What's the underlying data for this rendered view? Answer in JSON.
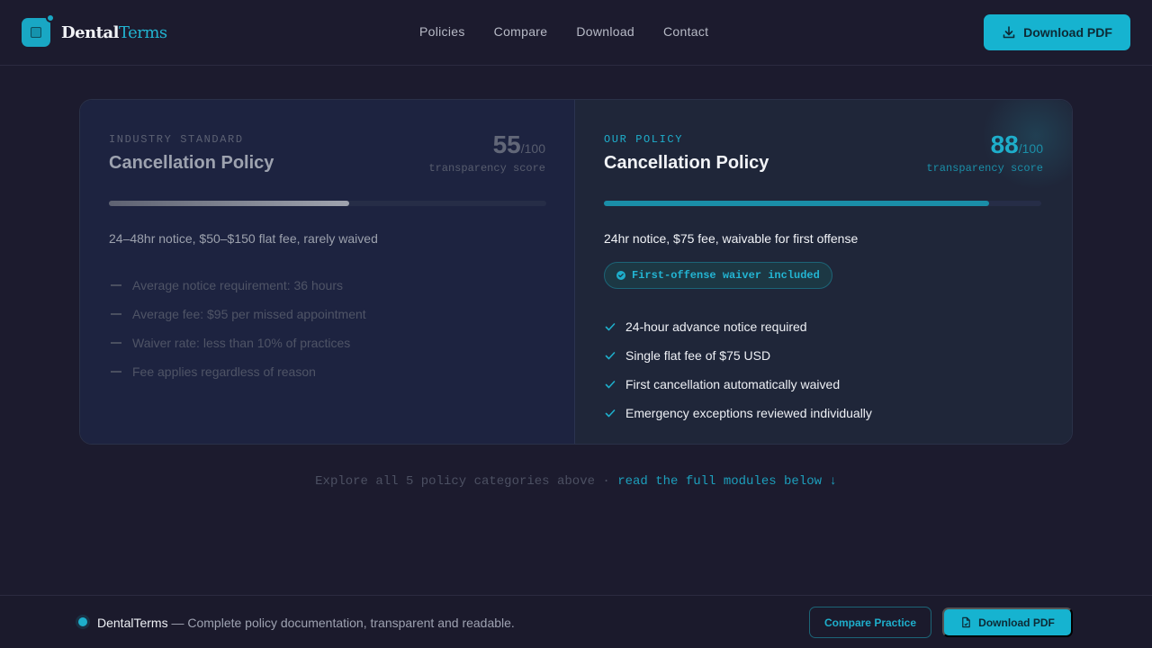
{
  "header": {
    "logo_part1": "Dental",
    "logo_part2": "Terms",
    "nav": [
      "Policies",
      "Compare",
      "Download",
      "Contact"
    ],
    "download_label": "Download PDF"
  },
  "comparison": {
    "industry": {
      "eyebrow": "INDUSTRY STANDARD",
      "title": "Cancellation Policy",
      "score": "55",
      "score_max": "/100",
      "score_label": "transparency score",
      "progress": 0.55,
      "summary": "24–48hr notice, $50–$150 flat fee, rarely waived",
      "items": [
        "Average notice requirement: 36 hours",
        "Average fee: $95 per missed appointment",
        "Waiver rate: less than 10% of practices",
        "Fee applies regardless of reason"
      ]
    },
    "ours": {
      "eyebrow": "OUR POLICY",
      "title": "Cancellation Policy",
      "score": "88",
      "score_max": "/100",
      "score_label": "transparency score",
      "progress": 0.88,
      "summary": "24hr notice, $75 fee, waivable for first offense",
      "badge": "First-offense waiver included",
      "items": [
        "24-hour advance notice required",
        "Single flat fee of $75 USD",
        "First cancellation automatically waived",
        "Emergency exceptions reviewed individually"
      ]
    }
  },
  "explore": {
    "text": "Explore all 5 policy categories above · ",
    "link": "read the full modules below ↓"
  },
  "footer": {
    "brand": "DentalTerms",
    "tagline": " — Complete policy documentation, transparent and readable.",
    "compare_label": "Compare Practice",
    "download_label": "Download PDF"
  },
  "colors": {
    "accent": "#16b3d0",
    "background": "#1c1b2e"
  }
}
